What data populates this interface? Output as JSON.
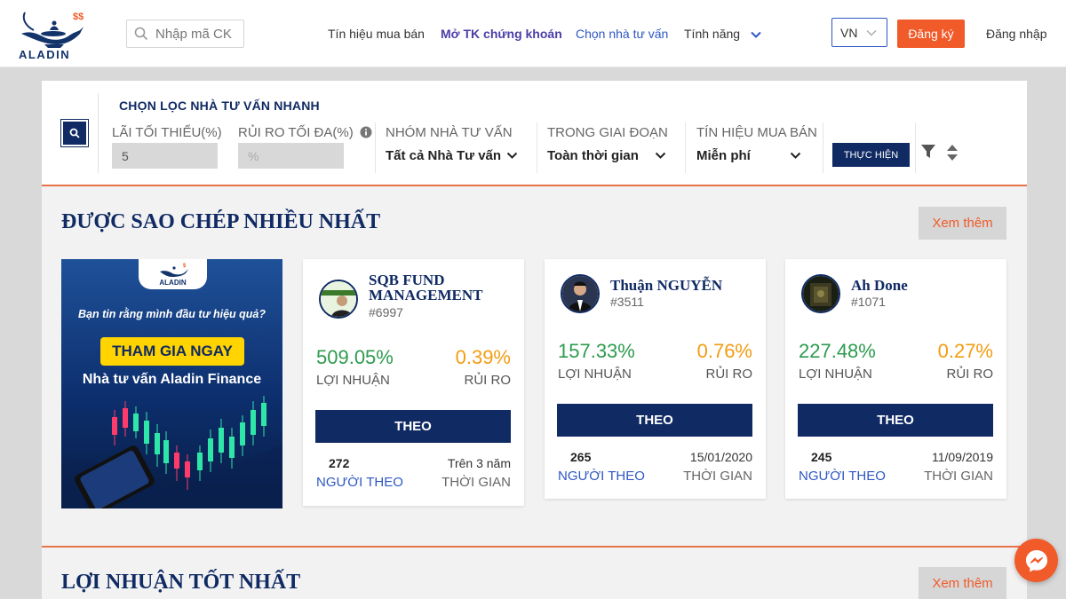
{
  "header": {
    "logo_text": "ALADIN",
    "search_placeholder": "Nhập mã CK",
    "nav": [
      "Tín hiệu mua bán",
      "Mở TK chứng khoán",
      "Chọn nhà tư vấn",
      "Tính năng"
    ],
    "language": "VN",
    "register_label": "Đăng ký",
    "login_label": "Đăng nhập"
  },
  "filter": {
    "title": "CHỌN LỌC NHÀ TƯ VẤN NHANH",
    "min_profit_label": "LÃI TỐI THIỂU(%)",
    "min_profit_value": "5",
    "max_risk_label": "RỦI RO TỐI ĐA(%)",
    "max_risk_placeholder": "%",
    "group_label": "NHÓM NHÀ TƯ VẤN",
    "group_value": "Tất cả Nhà Tư vấn",
    "period_label": "TRONG GIAI ĐOẠN",
    "period_value": "Toàn thời gian",
    "signal_label": "TÍN HIỆU MUA BÁN",
    "signal_value": "Miễn phí",
    "execute_label": "THỰC HIỆN"
  },
  "most_copied": {
    "title": "ĐƯỢC SAO CHÉP NHIỀU NHẤT",
    "more_label": "Xem thêm",
    "banner": {
      "tab_text": "ALADIN",
      "question": "Bạn tin rằng mình đầu tư hiệu quả?",
      "cta": "THAM GIA NGAY",
      "subtitle": "Nhà tư vấn Aladin Finance"
    },
    "cards": [
      {
        "name": "SQB FUND MANAGEMENT",
        "id": "#6997",
        "profit": "509.05%",
        "profit_label": "LỢI NHUẬN",
        "risk": "0.39%",
        "risk_label": "RỦI RO",
        "follow_label": "THEO",
        "followers": "272",
        "followers_label": "NGƯỜI THEO",
        "time": "Trên 3 năm",
        "time_label": "THỜI GIAN"
      },
      {
        "name": "Thuận NGUYỄN",
        "id": "#3511",
        "profit": "157.33%",
        "profit_label": "LỢI NHUẬN",
        "risk": "0.76%",
        "risk_label": "RỦI RO",
        "follow_label": "THEO",
        "followers": "265",
        "followers_label": "NGƯỜI THEO",
        "time": "15/01/2020",
        "time_label": "THỜI GIAN"
      },
      {
        "name": "Ah Done",
        "id": "#1071",
        "profit": "227.48%",
        "profit_label": "LỢI NHUẬN",
        "risk": "0.27%",
        "risk_label": "RỦI RO",
        "follow_label": "THEO",
        "followers": "245",
        "followers_label": "NGƯỜI THEO",
        "time": "11/09/2019",
        "time_label": "THỜI GIAN"
      }
    ]
  },
  "best_profit": {
    "title": "LỢI NHUẬN TỐT NHẤT",
    "more_label": "Xem thêm"
  },
  "colors": {
    "brand_navy": "#102a63",
    "accent_orange": "#f15a29",
    "profit_green": "#2e9b4f",
    "risk_amber": "#f39c12"
  }
}
